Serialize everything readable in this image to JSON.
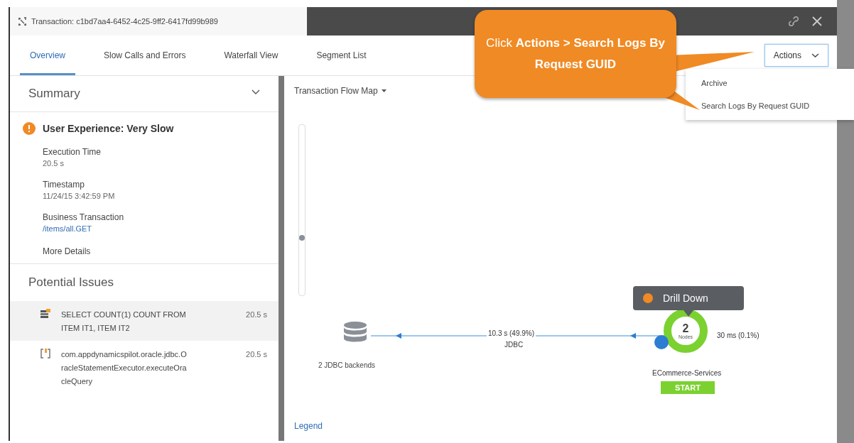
{
  "window": {
    "title": "Transaction: c1bd7aa4-6452-4c25-9ff2-6417fd99b989"
  },
  "tabs": [
    {
      "label": "Overview",
      "selected": true
    },
    {
      "label": "Slow Calls and Errors",
      "selected": false
    },
    {
      "label": "Waterfall View",
      "selected": false
    },
    {
      "label": "Segment List",
      "selected": false
    }
  ],
  "actions": {
    "label": "Actions",
    "expanded": true,
    "menu": [
      "Archive",
      "Search Logs By Request GUID"
    ]
  },
  "callout": {
    "text": "Click **Actions > Search Logs By Request GUID**"
  },
  "summary": {
    "title": "Summary",
    "expanded": true,
    "experience": "User Experience: Very Slow",
    "fields": [
      {
        "label": "Execution Time",
        "value": "20.5 s",
        "kind": "text"
      },
      {
        "label": "Timestamp",
        "value": "11/24/15 3:42:59 PM",
        "kind": "text"
      },
      {
        "label": "Business Transaction",
        "value": "/items/all.GET",
        "kind": "link"
      }
    ],
    "more": "More Details"
  },
  "issues": {
    "title": "Potential Issues",
    "items": [
      {
        "kind": "sql",
        "text": "SELECT COUNT(1) COUNT FROM ITEM IT1, ITEM IT2",
        "time": "20.5 s",
        "selected": true
      },
      {
        "kind": "method",
        "text": "com.appdynamicspilot.oracle.jdbc.OracleStatementExecutor.executeOracleQuery",
        "time": "20.5 s",
        "selected": false
      }
    ]
  },
  "flow_map": {
    "title": "Transaction Flow Map",
    "zoom": {
      "level": 0.32
    },
    "backend": {
      "label": "2 JDBC backends"
    },
    "edge": {
      "time": "10.3 s (49.9%)",
      "type": "JDBC"
    },
    "tier": {
      "count": "2",
      "unit": "Nodes",
      "name": "ECommerce-Services",
      "badge": "START",
      "time": "30 ms (0.1%)"
    },
    "tooltip": "Drill Down",
    "legend": "Legend"
  }
}
